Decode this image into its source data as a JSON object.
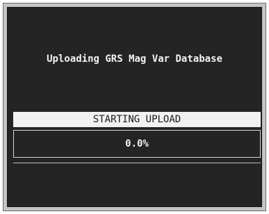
{
  "dialog": {
    "message": "Uploading GRS Mag Var Database",
    "status": "STARTING UPLOAD",
    "progress_text": "0.0%",
    "progress_fraction": 0.0
  },
  "colors": {
    "panel_background": "#242424",
    "frame": "#c4c4c4",
    "status_bar_background": "#f1f1f1",
    "text": "#f2f2f2"
  }
}
